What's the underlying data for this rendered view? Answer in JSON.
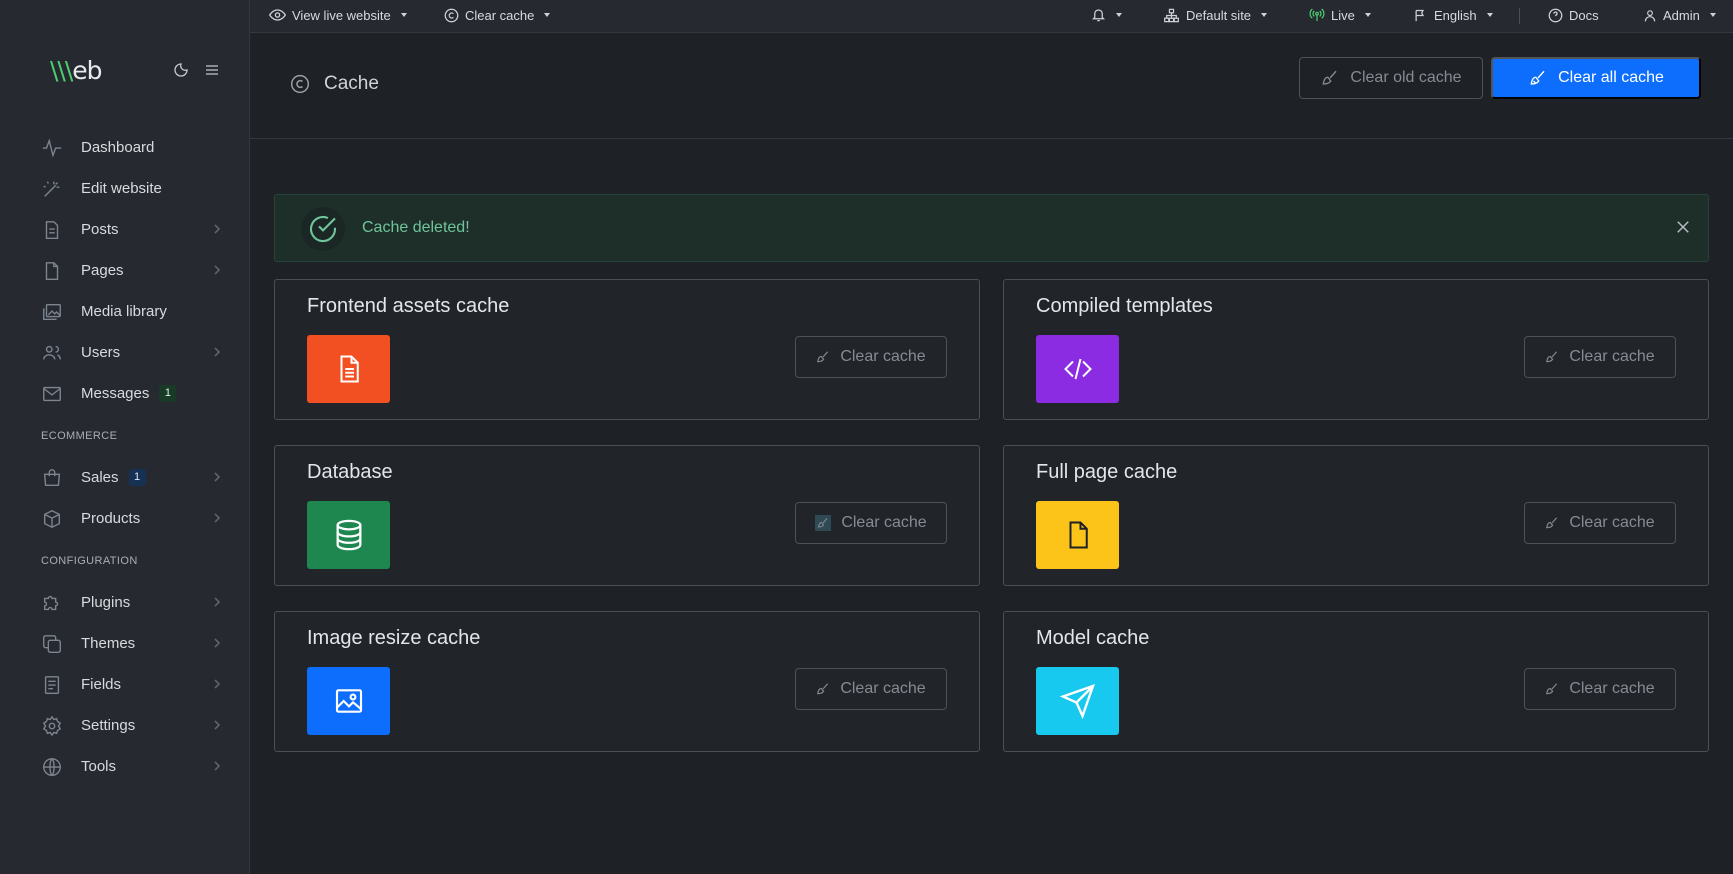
{
  "topbar": {
    "view_live": "View live website",
    "clear_cache": "Clear cache",
    "site": "Default site",
    "live": "Live",
    "language": "English",
    "docs": "Docs",
    "user": "Admin"
  },
  "sidebar": {
    "logo_prefix": "\\\\\\",
    "logo_suffix": "eb",
    "items": [
      {
        "label": "Dashboard"
      },
      {
        "label": "Edit website"
      },
      {
        "label": "Posts"
      },
      {
        "label": "Pages"
      },
      {
        "label": "Media library"
      },
      {
        "label": "Users"
      },
      {
        "label": "Messages",
        "badge": "1"
      }
    ],
    "section_ecommerce": "ECOMMERCE",
    "ecommerce": [
      {
        "label": "Sales",
        "badge": "1"
      },
      {
        "label": "Products"
      }
    ],
    "section_configuration": "CONFIGURATION",
    "configuration": [
      {
        "label": "Plugins"
      },
      {
        "label": "Themes"
      },
      {
        "label": "Fields"
      },
      {
        "label": "Settings"
      },
      {
        "label": "Tools"
      }
    ]
  },
  "header": {
    "title": "Cache",
    "clear_old": "Clear old cache",
    "clear_all": "Clear all cache"
  },
  "alert": {
    "text": "Cache deleted!"
  },
  "cards": [
    {
      "title": "Frontend assets cache",
      "button": "Clear cache",
      "color": "#f25022",
      "icon": "file-text-icon"
    },
    {
      "title": "Compiled templates",
      "button": "Clear cache",
      "color": "#8b2be2",
      "icon": "code-icon"
    },
    {
      "title": "Database",
      "button": "Clear cache",
      "color": "#1e874f",
      "icon": "database-icon"
    },
    {
      "title": "Full page cache",
      "button": "Clear cache",
      "color": "#fcc419",
      "icon": "file-icon"
    },
    {
      "title": "Image resize cache",
      "button": "Clear cache",
      "color": "#0d6efd",
      "icon": "image-icon"
    },
    {
      "title": "Model cache",
      "button": "Clear cache",
      "color": "#17c9ef",
      "icon": "send-icon"
    }
  ],
  "colors": {
    "primary": "#0d6efd",
    "success_text": "#6fc49a",
    "logo_accent": "#4ccf6f"
  }
}
